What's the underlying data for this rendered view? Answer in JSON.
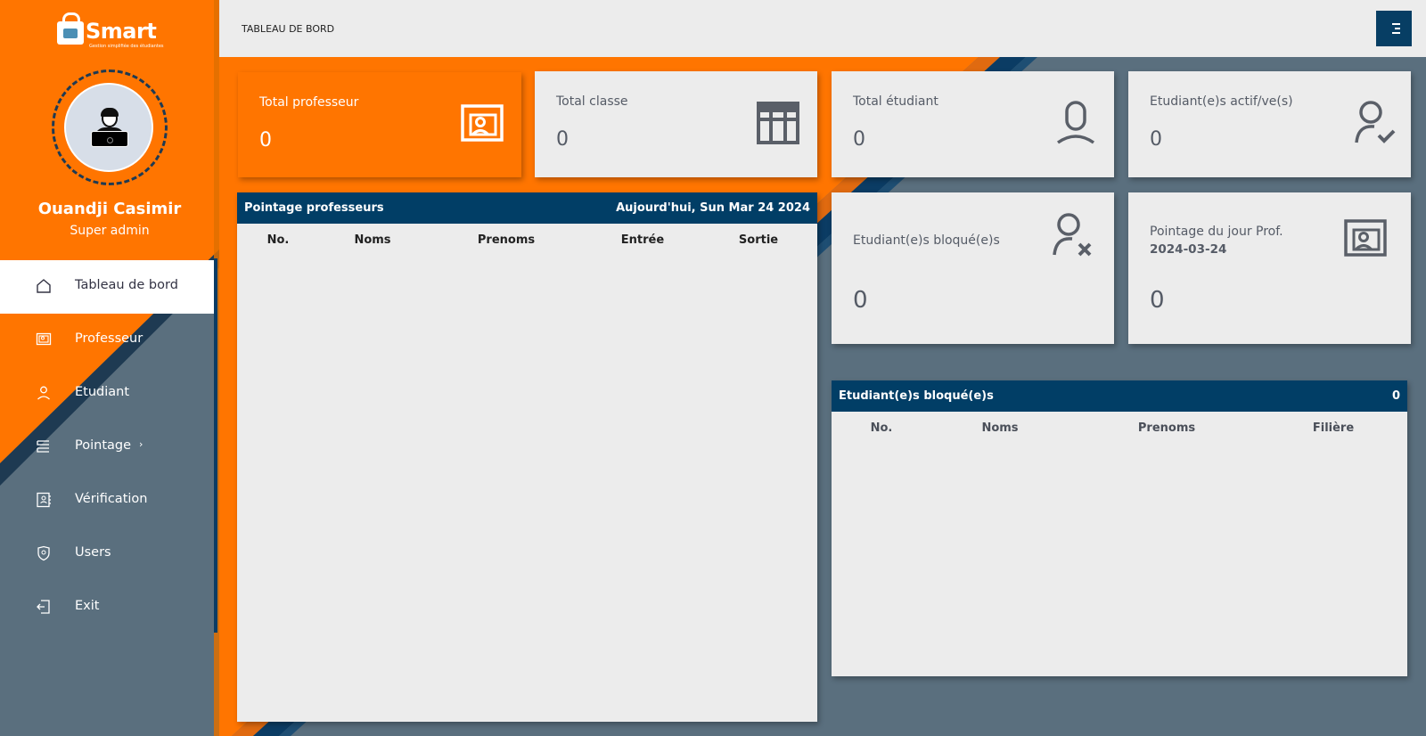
{
  "sidebar": {
    "logo_text": "Smart",
    "logo_subtitle": "Gestion simplifiée des étudiantes",
    "user_name": "Ouandji Casimir",
    "user_role": "Super admin",
    "items": [
      {
        "label": "Tableau de bord",
        "icon": "home-icon",
        "active": true
      },
      {
        "label": "Professeur",
        "icon": "presentation-icon"
      },
      {
        "label": "Etudiant",
        "icon": "user-icon"
      },
      {
        "label": "Pointage",
        "icon": "list-icon",
        "caret": "›"
      },
      {
        "label": "Vérification",
        "icon": "contact-book-icon"
      },
      {
        "label": "Users",
        "icon": "shield-icon"
      },
      {
        "label": "Exit",
        "icon": "logout-icon"
      }
    ]
  },
  "header": {
    "title": "TABLEAU DE BORD",
    "menu_icon": "menu-icon"
  },
  "colors": {
    "accent_orange": "#ff7500",
    "navy": "#013e66",
    "slate": "#5a6f7e"
  },
  "cards": {
    "total_professeur": {
      "label": "Total professeur",
      "value": "0",
      "icon": "presentation-icon"
    },
    "total_classe": {
      "label": "Total classe",
      "value": "0",
      "icon": "table-icon"
    },
    "total_etudiant": {
      "label": "Total étudiant",
      "value": "0",
      "icon": "user-icon"
    },
    "etudiants_actifs": {
      "label": "Etudiant(e)s actif/ve(s)",
      "value": "0",
      "icon": "user-check-icon"
    },
    "etudiants_bloques": {
      "label": "Etudiant(e)s bloqué(e)s",
      "value": "0",
      "icon": "user-x-icon"
    },
    "pointage_jour": {
      "label": "Pointage du jour Prof.",
      "date": "2024-03-24",
      "value": "0",
      "icon": "presentation-icon"
    }
  },
  "pointage_table": {
    "title": "Pointage professeurs",
    "date_text": "Aujourd'hui, Sun Mar 24 2024",
    "columns": [
      "No.",
      "Noms",
      "Prenoms",
      "Entrée",
      "Sortie"
    ],
    "rows": []
  },
  "blocked_table": {
    "title": "Etudiant(e)s bloqué(e)s",
    "count": "0",
    "columns": [
      "No.",
      "Noms",
      "Prenoms",
      "Filière"
    ],
    "rows": []
  }
}
